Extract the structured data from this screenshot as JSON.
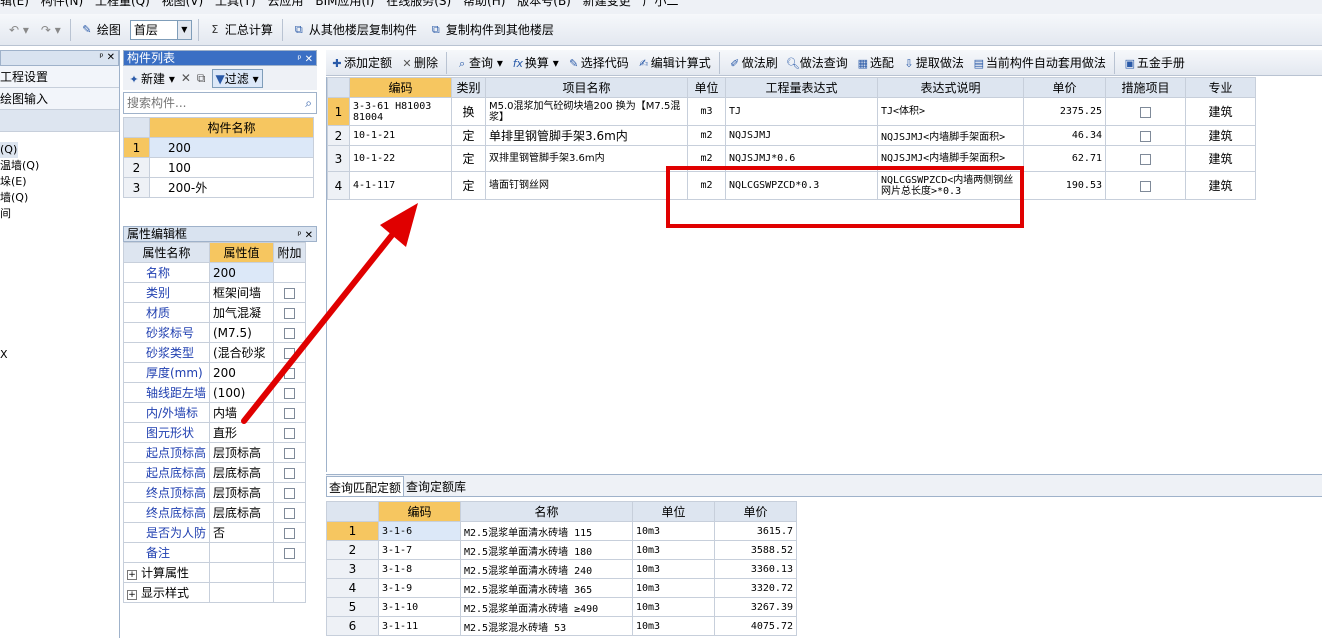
{
  "menu": [
    "辑(E)",
    "构件(N)",
    "工程量(Q)",
    "视图(V)",
    "工具(T)",
    "云应用",
    "BIM应用(I)",
    "在线服务(S)",
    "帮助(H)",
    "版本号(B)",
    "新建变更",
    "广小二"
  ],
  "toolbar": {
    "draw_label": "绘图",
    "floor_value": "首层",
    "sum_label": "汇总计算",
    "copy_from_label": "从其他楼层复制构件",
    "copy_to_label": "复制构件到其他楼层"
  },
  "left_nav": {
    "items": [
      "工程设置",
      "绘图输入"
    ],
    "fragments": [
      "(Q)",
      "温墙(Q)",
      "垛(E)",
      "墙(Q)",
      "间",
      "",
      "",
      "",
      "",
      "",
      "",
      "",
      "",
      "X"
    ]
  },
  "component_list": {
    "title": "构件列表",
    "new_label": "新建",
    "filter_label": "过滤",
    "search_placeholder": "搜索构件...",
    "header": "构件名称",
    "rows": [
      {
        "n": "1",
        "name": "200"
      },
      {
        "n": "2",
        "name": "100"
      },
      {
        "n": "3",
        "name": "200-外"
      }
    ]
  },
  "properties": {
    "title": "属性编辑框",
    "headers": [
      "属性名称",
      "属性值",
      "附加"
    ],
    "rows": [
      {
        "name": "名称",
        "value": "200",
        "cb": false
      },
      {
        "name": "类别",
        "value": "框架间墙",
        "cb": true
      },
      {
        "name": "材质",
        "value": "加气混凝",
        "cb": true
      },
      {
        "name": "砂浆标号",
        "value": "(M7.5)",
        "cb": true
      },
      {
        "name": "砂浆类型",
        "value": "(混合砂浆",
        "cb": true
      },
      {
        "name": "厚度(mm)",
        "value": "200",
        "cb": true
      },
      {
        "name": "轴线距左墙",
        "value": "(100)",
        "cb": true
      },
      {
        "name": "内/外墙标",
        "value": "内墙",
        "cb": true
      },
      {
        "name": "图元形状",
        "value": "直形",
        "cb": true
      },
      {
        "name": "起点顶标高",
        "value": "层顶标高",
        "cb": true
      },
      {
        "name": "起点底标高",
        "value": "层底标高",
        "cb": true
      },
      {
        "name": "终点顶标高",
        "value": "层顶标高",
        "cb": true
      },
      {
        "name": "终点底标高",
        "value": "层底标高",
        "cb": true
      },
      {
        "name": "是否为人防",
        "value": "否",
        "cb": true
      },
      {
        "name": "备注",
        "value": "",
        "cb": true
      },
      {
        "name": "计算属性",
        "value": "",
        "cb": false
      },
      {
        "name": "显示样式",
        "value": "",
        "cb": false
      }
    ]
  },
  "quota_toolbar": [
    "添加定额",
    "删除",
    "查询",
    "换算",
    "选择代码",
    "编辑计算式",
    "做法刷",
    "做法查询",
    "选配",
    "提取做法",
    "当前构件自动套用做法",
    "五金手册"
  ],
  "quota_table": {
    "headers": [
      "编码",
      "类别",
      "项目名称",
      "单位",
      "工程量表达式",
      "表达式说明",
      "单价",
      "措施项目",
      "专业"
    ],
    "rows": [
      {
        "n": "1",
        "code": "3-3-61 H81003 81004",
        "type": "换",
        "name": "M5.0混浆加气砼砌块墙200 换为【M7.5混浆】",
        "unit": "m3",
        "expr": "TJ",
        "desc": "TJ<体积>",
        "price": "2375.25",
        "major": "建筑"
      },
      {
        "n": "2",
        "code": "10-1-21",
        "type": "定",
        "name": "单排里钢管脚手架3.6m内",
        "unit": "m2",
        "expr": "NQJSJMJ",
        "desc": "NQJSJMJ<内墙脚手架面积>",
        "price": "46.34",
        "major": "建筑"
      },
      {
        "n": "3",
        "code": "10-1-22",
        "type": "定",
        "name": "双排里钢管脚手架3.6m内",
        "unit": "m2",
        "expr": "NQJSJMJ*0.6",
        "desc": "NQJSJMJ<内墙脚手架面积>",
        "price": "62.71",
        "major": "建筑"
      },
      {
        "n": "4",
        "code": "4-1-117",
        "type": "定",
        "name": "墙面钉钢丝网",
        "unit": "m2",
        "expr": "NQLCGSWPZCD*0.3",
        "desc": "NQLCGSWPZCD<内墙两侧钢丝网片总长度>*0.3",
        "price": "190.53",
        "major": "建筑"
      }
    ]
  },
  "bottom": {
    "tabs": [
      "查询匹配定额",
      "查询定额库"
    ],
    "headers": [
      "编码",
      "名称",
      "单位",
      "单价"
    ],
    "rows": [
      {
        "n": "1",
        "code": "3-1-6",
        "name": "M2.5混浆单面清水砖墙 115",
        "unit": "10m3",
        "price": "3615.7"
      },
      {
        "n": "2",
        "code": "3-1-7",
        "name": "M2.5混浆单面清水砖墙 180",
        "unit": "10m3",
        "price": "3588.52"
      },
      {
        "n": "3",
        "code": "3-1-8",
        "name": "M2.5混浆单面清水砖墙 240",
        "unit": "10m3",
        "price": "3360.13"
      },
      {
        "n": "4",
        "code": "3-1-9",
        "name": "M2.5混浆单面清水砖墙 365",
        "unit": "10m3",
        "price": "3320.72"
      },
      {
        "n": "5",
        "code": "3-1-10",
        "name": "M2.5混浆单面清水砖墙 ≥490",
        "unit": "10m3",
        "price": "3267.39"
      },
      {
        "n": "6",
        "code": "3-1-11",
        "name": "M2.5混浆混水砖墙 53",
        "unit": "10m3",
        "price": "4075.72"
      }
    ]
  }
}
